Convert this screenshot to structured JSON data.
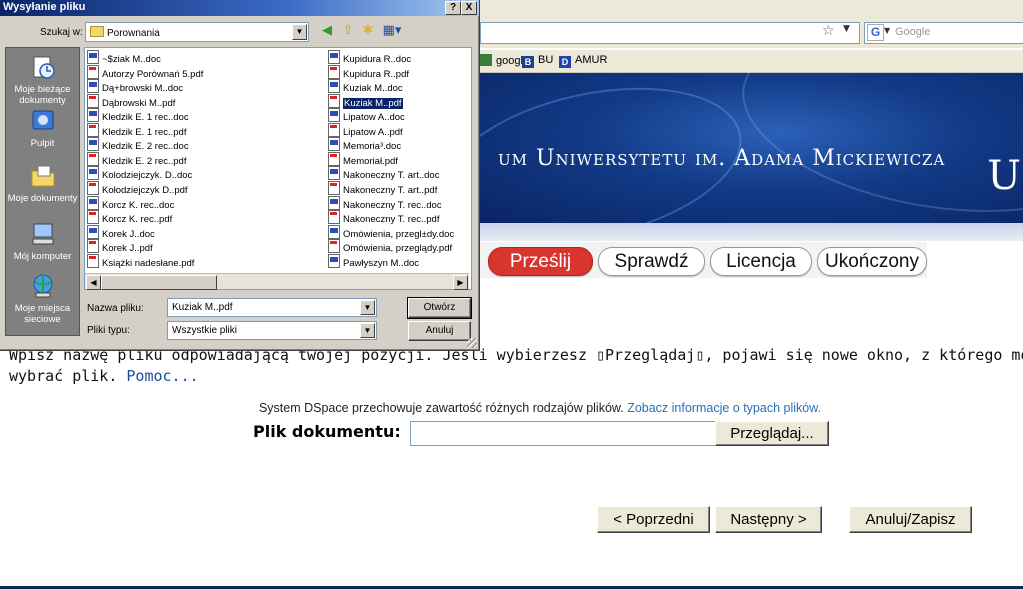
{
  "browser": {
    "search_placeholder": "Google",
    "google_logo": "G",
    "bookmarks": [
      {
        "label": "google",
        "icon": "bookmark-icon",
        "color": "#3a7d3a"
      },
      {
        "label": "BU",
        "icon": "bu-icon",
        "color": "#1f3f8f"
      },
      {
        "label": "AMUR",
        "icon": "amur-icon",
        "color": "#2244aa"
      }
    ]
  },
  "banner": {
    "title": "um Uniwersytetu im. Adama Mickiewicza",
    "edge_letter": "U"
  },
  "steps": [
    {
      "label": "Prześlij",
      "active": true
    },
    {
      "label": "Sprawdź",
      "active": false
    },
    {
      "label": "Licencja",
      "active": false
    },
    {
      "label": "Ukończony",
      "active": false
    }
  ],
  "content": {
    "instruction_line1": "Wpisz nazwę pliku odpowiadającą twojej pozycji. Jeśli wybierzesz ▯Przeglądaj▯, pojawi się nowe okno, z którego możesz",
    "instruction_line2": "wybrać plik. ",
    "help_link": "Pomoc...",
    "info_text": "System DSpace przechowuje zawartość różnych rodzajów plików. ",
    "info_link": "Zobacz informacje o typach plików.",
    "file_label": "Plik dokumentu:",
    "file_value": "",
    "browse_button": "Przeglądaj...",
    "prev_button": "< Poprzedni",
    "next_button": "Następny >",
    "cancel_button": "Anuluj/Zapisz"
  },
  "dialog": {
    "title": "Wysyłanie pliku",
    "help_btn": "?",
    "close_btn": "X",
    "look_in_label": "Szukaj w:",
    "look_in_value": "Porownania",
    "places": [
      {
        "label": "Moje bieżące dokumenty",
        "icon": "recent-documents-icon"
      },
      {
        "label": "Pulpit",
        "icon": "desktop-icon"
      },
      {
        "label": "Moje dokumenty",
        "icon": "my-documents-icon"
      },
      {
        "label": "Mój komputer",
        "icon": "my-computer-icon"
      },
      {
        "label": "Moje miejsca sieciowe",
        "icon": "network-places-icon"
      }
    ],
    "files_col1": [
      {
        "name": "~$ziak M..doc",
        "type": "doc"
      },
      {
        "name": "Autorzy Porównań 5.pdf",
        "type": "pdf"
      },
      {
        "name": "Dą+browski M..doc",
        "type": "doc"
      },
      {
        "name": "Dąbrowski M..pdf",
        "type": "pdf"
      },
      {
        "name": "Kledzik E. 1 rec..doc",
        "type": "doc"
      },
      {
        "name": "Kledzik E. 1 rec..pdf",
        "type": "pdf"
      },
      {
        "name": "Kledzik E. 2 rec..doc",
        "type": "doc"
      },
      {
        "name": "Kledzik E. 2 rec..pdf",
        "type": "pdf"
      },
      {
        "name": "Kolodziejczyk. D..doc",
        "type": "doc"
      },
      {
        "name": "Kołodziejczyk D..pdf",
        "type": "pdf"
      },
      {
        "name": "Korcz K. rec..doc",
        "type": "doc"
      },
      {
        "name": "Korcz K. rec..pdf",
        "type": "pdf"
      },
      {
        "name": "Korek J..doc",
        "type": "doc"
      },
      {
        "name": "Korek J..pdf",
        "type": "pdf"
      },
      {
        "name": "Książki nadesłane.pdf",
        "type": "pdf"
      }
    ],
    "files_col2": [
      {
        "name": "Kupidura R..doc",
        "type": "doc"
      },
      {
        "name": "Kupidura R..pdf",
        "type": "pdf"
      },
      {
        "name": "Kuziak M..doc",
        "type": "doc"
      },
      {
        "name": "Kuziak M..pdf",
        "type": "pdf",
        "selected": true
      },
      {
        "name": "Lipatow A..doc",
        "type": "doc"
      },
      {
        "name": "Lipatow A..pdf",
        "type": "pdf"
      },
      {
        "name": "Memoria³.doc",
        "type": "doc"
      },
      {
        "name": "Memoriał.pdf",
        "type": "pdf"
      },
      {
        "name": "Nakoneczny T. art..doc",
        "type": "doc"
      },
      {
        "name": "Nakoneczny T. art..pdf",
        "type": "pdf"
      },
      {
        "name": "Nakoneczny T. rec..doc",
        "type": "doc"
      },
      {
        "name": "Nakoneczny T. rec..pdf",
        "type": "pdf"
      },
      {
        "name": "Omówienia, przegl±dy.doc",
        "type": "doc"
      },
      {
        "name": "Omówienia, przeglądy.pdf",
        "type": "pdf"
      },
      {
        "name": "Pawłyszyn M..doc",
        "type": "doc"
      }
    ],
    "filename_label": "Nazwa pliku:",
    "filename_value": "Kuziak M..pdf",
    "filetype_label": "Pliki typu:",
    "filetype_value": "Wszystkie pliki",
    "open_button": "Otwórz",
    "cancel_button": "Anuluj"
  }
}
